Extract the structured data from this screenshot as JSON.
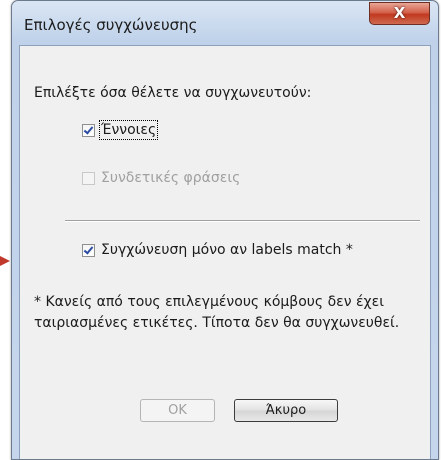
{
  "window": {
    "title": "Επιλογές συγχώνευσης",
    "close_glyph": "X"
  },
  "dialog": {
    "prompt": "Επιλέξτε όσα θέλετε να συγχωνευτούν:",
    "options": [
      {
        "label": "Έννοιες",
        "checked": true,
        "enabled": true
      },
      {
        "label": "Συνδετικές φράσεις",
        "checked": false,
        "enabled": false
      }
    ],
    "match_option": {
      "label": "Συγχώνευση μόνο αν labels match  *",
      "checked": true,
      "enabled": true
    },
    "note": "* Κανείς από τους επιλεγμένους κόμβους δεν έχει ταιριασμένες ετικέτες. Τίποτα δεν θα συγχωνευθεί.",
    "buttons": {
      "ok": "OK",
      "cancel": "Άκυρο"
    }
  },
  "colors": {
    "check_mark": "#2b4aa1",
    "close_button": "#c0391f",
    "pointer_arrow": "#c0392b"
  }
}
